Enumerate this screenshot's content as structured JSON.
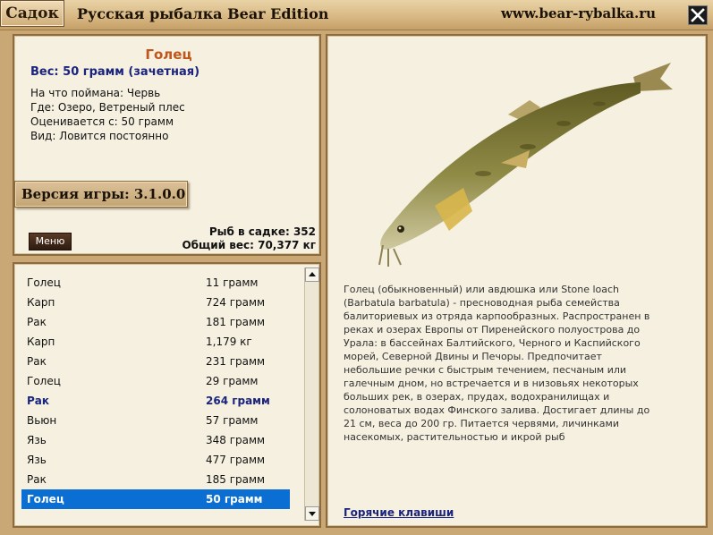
{
  "titlebar": {
    "sadok_label": "Садок",
    "title": "Русская рыбалка Bear Edition",
    "url": "www.bear-rybalka.ru"
  },
  "fish": {
    "name": "Голец",
    "weight": "Вес: 50 грамм (зачетная)",
    "caught_on": "На что поймана: Червь",
    "location": "Где: Озеро, Ветреный плес",
    "valued_from": "Оценивается с: 50 грамм",
    "kind": "Вид: Ловится постоянно"
  },
  "version": "Версия игры: 3.1.0.0",
  "menu_label": "Меню",
  "totals": {
    "count": "Рыб в садке: 352",
    "total_weight": "Общий вес: 70,377 кг"
  },
  "catch_list": [
    {
      "name": "Голец",
      "weight": "11 грамм",
      "state": "normal"
    },
    {
      "name": "Карп",
      "weight": "724 грамм",
      "state": "normal"
    },
    {
      "name": "Рак",
      "weight": "181 грамм",
      "state": "normal"
    },
    {
      "name": "Карп",
      "weight": "1,179 кг",
      "state": "normal"
    },
    {
      "name": "Рак",
      "weight": "231 грамм",
      "state": "normal"
    },
    {
      "name": "Голец",
      "weight": "29 грамм",
      "state": "normal"
    },
    {
      "name": "Рак",
      "weight": "264 грамм",
      "state": "highlight"
    },
    {
      "name": "Вьюн",
      "weight": "57 грамм",
      "state": "normal"
    },
    {
      "name": "Язь",
      "weight": "348 грамм",
      "state": "normal"
    },
    {
      "name": "Язь",
      "weight": "477 грамм",
      "state": "normal"
    },
    {
      "name": "Рак",
      "weight": "185 грамм",
      "state": "normal"
    },
    {
      "name": "Голец",
      "weight": "50 грамм",
      "state": "selected"
    }
  ],
  "description_lines": [
    "Голец (обыкновенный) или авдюшка или Stone loach",
    "(Barbatula barbatula) - пресноводная рыба семейства",
    "балиториевых из отряда карпообразных. Распространен в",
    "реках и озерах Европы от Пиренейского полуострова до",
    "Урала: в бассейнах Балтийского, Черного и Каспийского",
    "морей, Северной Двины и Печоры. Предпочитает",
    "небольшие речки с быстрым течением, песчаным или",
    "галечным дном, но встречается и в низовьях некоторых",
    "больших рек, в озерах, прудах, водохранилищах и",
    "солоноватых водах Финского залива. Достигает длины до",
    "21 см, веса до 200 гр. Питается червями, личинками",
    "насекомых, растительностью и икрой рыб"
  ],
  "hotkeys_link": "Горячие клавиши",
  "icons": {
    "close": "close-icon",
    "scroll_up": "arrow-up-icon",
    "scroll_down": "arrow-down-icon"
  },
  "colors": {
    "frame": "#c9a876",
    "panel": "#f5f0df",
    "fish_name": "#c0561c",
    "accent_text": "#1a237e",
    "selection": "#0a6ed2"
  }
}
